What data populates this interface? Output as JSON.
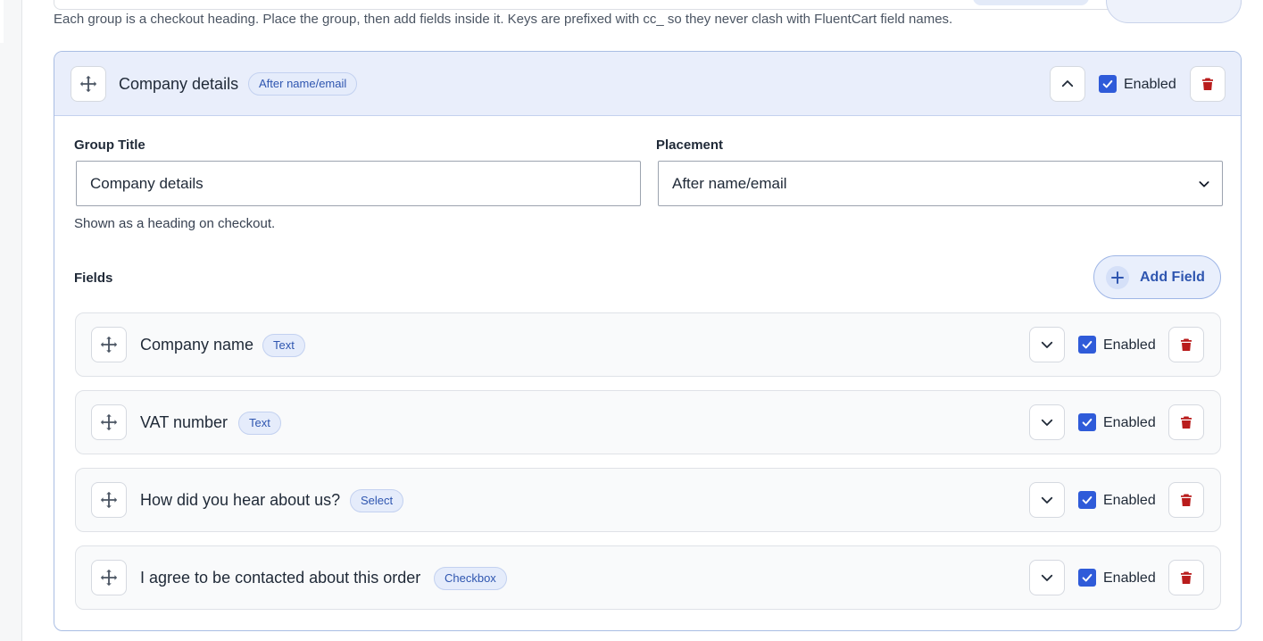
{
  "help_text": "Each group is a checkout heading. Place the group, then add fields inside it. Keys are prefixed with cc_ so they never clash with FluentCart field names.",
  "group": {
    "title": "Company details",
    "placement_badge": "After name/email",
    "enabled_label": "Enabled",
    "enabled": true,
    "group_title_label": "Group Title",
    "group_title_value": "Company details",
    "group_title_hint": "Shown as a heading on checkout.",
    "placement_label": "Placement",
    "placement_value": "After name/email",
    "fields_label": "Fields",
    "add_field_label": "Add Field"
  },
  "fields": [
    {
      "title": "Company name",
      "type": "Text",
      "enabled_label": "Enabled",
      "enabled": true
    },
    {
      "title": "VAT number",
      "type": "Text",
      "enabled_label": "Enabled",
      "enabled": true
    },
    {
      "title": "How did you hear about us?",
      "type": "Select",
      "enabled_label": "Enabled",
      "enabled": true
    },
    {
      "title": "I agree to be contacted about this order",
      "type": "Checkbox",
      "enabled_label": "Enabled",
      "enabled": true
    }
  ],
  "colors": {
    "accent": "#2f5bd9",
    "badge_text": "#2f56b0",
    "header_bg": "#e9eefb",
    "danger": "#b91c1c"
  },
  "icons": {
    "drag": "move-handle-icon",
    "collapse": "chevron-up-icon",
    "expand": "chevron-down-icon",
    "delete": "trash-icon",
    "add": "plus-icon",
    "check": "checkmark-icon"
  }
}
